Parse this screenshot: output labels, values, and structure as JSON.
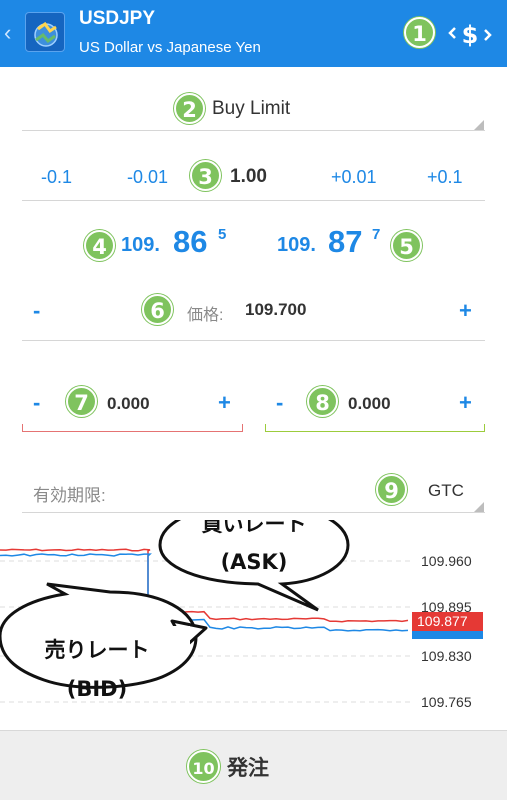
{
  "header": {
    "back_glyph": "‹",
    "symbol": "USDJPY",
    "description": "US Dollar vs Japanese Yen",
    "badge": "1",
    "trade_icon": "dollar-swap-icon"
  },
  "order_type": {
    "badge": "2",
    "label": "Buy Limit"
  },
  "volume": {
    "badge": "3",
    "dec_big": "-0.1",
    "dec_small": "-0.01",
    "value": "1.00",
    "inc_small": "+0.01",
    "inc_big": "+0.1"
  },
  "quotes": {
    "bid": {
      "badge": "4",
      "prefix": "109.",
      "big": "86",
      "sup": "5"
    },
    "ask": {
      "badge": "5",
      "prefix": "109.",
      "big": "87",
      "sup": "7"
    }
  },
  "price": {
    "badge": "6",
    "minus": "-",
    "label": "価格:",
    "value": "109.700",
    "plus": "+"
  },
  "stop_loss": {
    "badge": "7",
    "minus": "-",
    "value": "0.000",
    "plus": "+"
  },
  "take_profit": {
    "badge": "8",
    "minus": "-",
    "value": "0.000",
    "plus": "+"
  },
  "expiration": {
    "badge": "9",
    "label": "有効期限:",
    "value": "GTC"
  },
  "chart_data": {
    "type": "line",
    "series": [
      {
        "color": "#e53935"
      },
      {
        "color": "#1e88e5"
      }
    ],
    "y_ticks": [
      "109.960",
      "109.895",
      "109.830",
      "109.765"
    ],
    "current_ask_label": "109.877",
    "ask_callout": {
      "line1": "買いレート",
      "line2": "(ASK)"
    },
    "bid_callout": {
      "line1": "売りレート",
      "line2": "(BID)"
    }
  },
  "footer": {
    "badge": "10",
    "label": "発注"
  },
  "colors": {
    "accent": "#1e88e5",
    "badge": "#7fc35e",
    "sl": "#e57373",
    "tp": "#9ccc3c",
    "ask": "#e53935"
  }
}
